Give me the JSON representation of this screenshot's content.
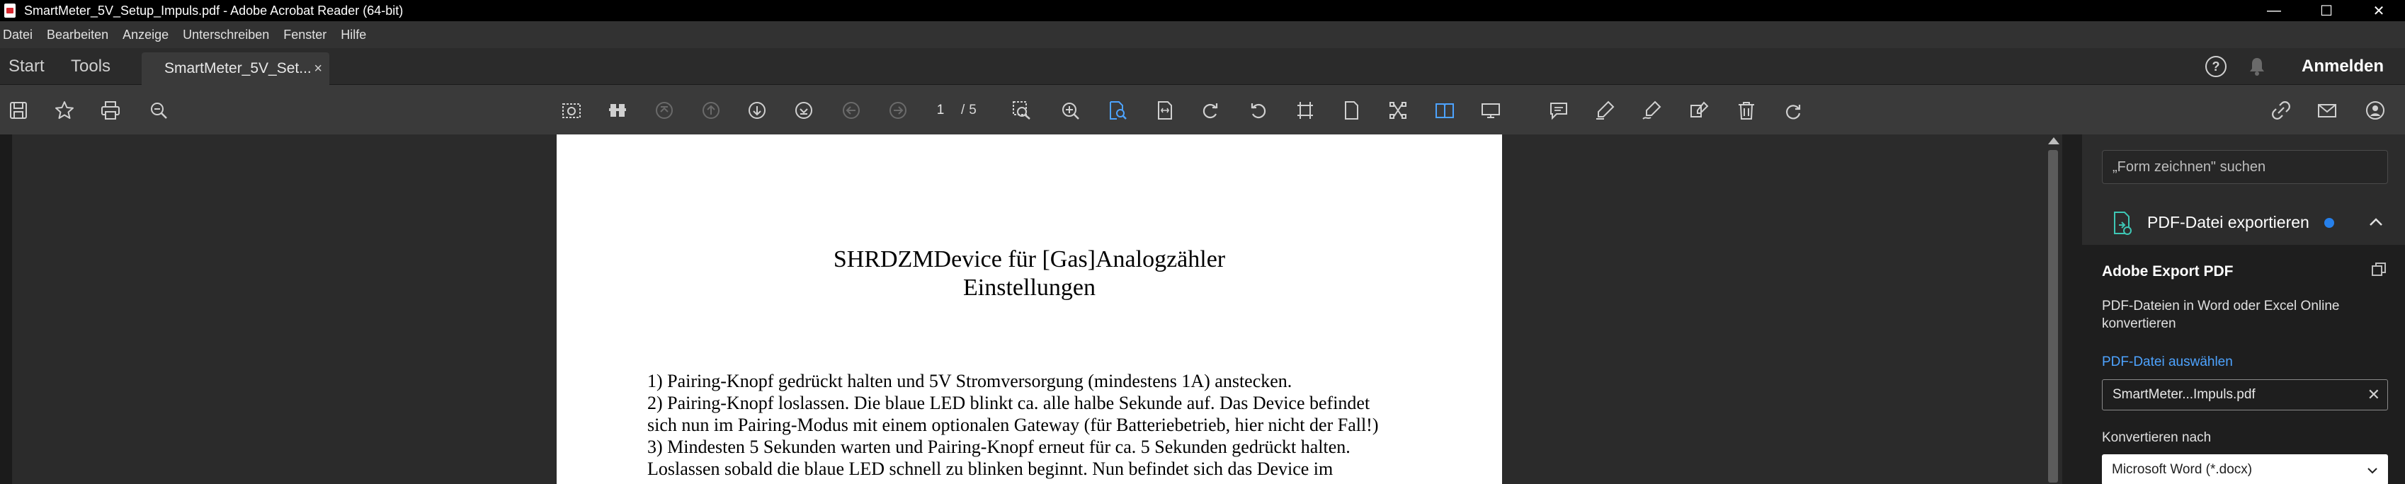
{
  "window": {
    "title": "SmartMeter_5V_Setup_Impuls.pdf - Adobe Acrobat Reader (64-bit)",
    "controls": {
      "minimize": "—",
      "maximize": "☐",
      "close": "✕"
    }
  },
  "menu": [
    "Datei",
    "Bearbeiten",
    "Anzeige",
    "Unterschreiben",
    "Fenster",
    "Hilfe"
  ],
  "tabs": {
    "start": "Start",
    "tools": "Tools",
    "document": "SmartMeter_5V_Set...",
    "close": "×"
  },
  "header": {
    "help": "?",
    "signin": "Anmelden"
  },
  "toolbar": {
    "page_current": "1",
    "page_separator": "/",
    "page_total": "5",
    "accent_color": "#4da3ff"
  },
  "document": {
    "title_line1": "SHRDZMDevice für [Gas]Analogzähler",
    "title_line2": "Einstellungen",
    "lines": [
      "1) Pairing-Knopf gedrückt halten und 5V Stromversorgung (mindestens 1A) anstecken.",
      "2) Pairing-Knopf loslassen. Die blaue LED blinkt ca. alle halbe Sekunde auf. Das Device befindet",
      "sich nun im Pairing-Modus mit einem optionalen Gateway (für Batteriebetrieb, hier nicht der Fall!)",
      "3) Mindesten 5 Sekunden warten und Pairing-Knopf erneut für ca. 5 Sekunden gedrückt halten.",
      "Loslassen sobald die blaue LED schnell zu blinken beginnt. Nun befindet sich das Device im"
    ]
  },
  "right_pane": {
    "search_placeholder": "„Form zeichnen\" suchen",
    "export_title": "PDF-Datei exportieren",
    "export_box": {
      "title": "Adobe Export PDF",
      "description": "PDF-Dateien in Word oder Excel Online konvertieren",
      "select_link": "PDF-Datei auswählen",
      "file_name": "SmartMeter...Impuls.pdf",
      "file_clear": "✕",
      "convert_label": "Konvertieren nach",
      "convert_value": "Microsoft Word (*.docx)"
    }
  }
}
